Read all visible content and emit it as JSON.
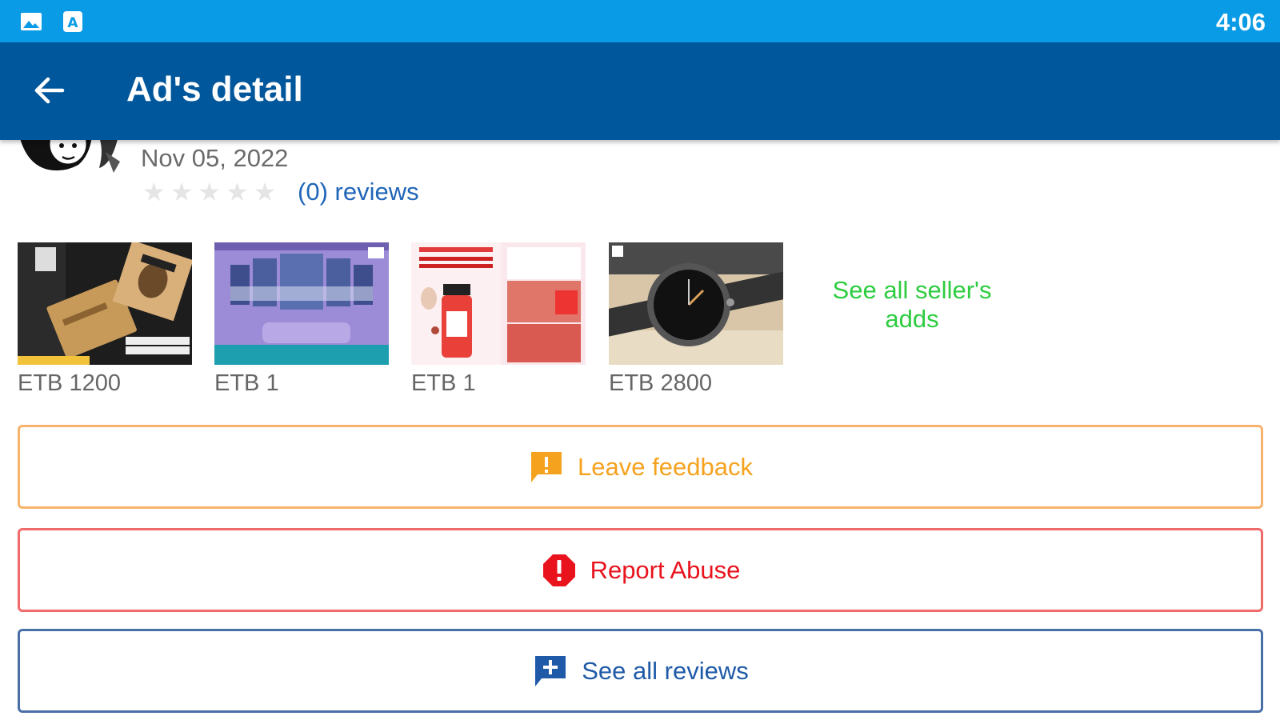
{
  "status_bar": {
    "time": "4:06",
    "icons": [
      "image-icon",
      "app-store-icon"
    ],
    "background": "#0a9be6"
  },
  "app_bar": {
    "title": "Ad's detail",
    "back_icon": "arrow-left-icon",
    "background": "#01579b"
  },
  "seller": {
    "date": "Nov 05, 2022",
    "rating": 0,
    "max_rating": 5,
    "reviews_label": "(0) reviews"
  },
  "seller_ads": [
    {
      "price": "ETB 1200",
      "image_desc": "wooden notebook"
    },
    {
      "price": "ETB 1",
      "image_desc": "wall art room"
    },
    {
      "price": "ETB 1",
      "image_desc": "skin serum"
    },
    {
      "price": "ETB 2800",
      "image_desc": "wrist watch"
    }
  ],
  "see_all_adds": "See all seller's adds",
  "buttons": {
    "feedback": {
      "label": "Leave feedback",
      "icon": "feedback-icon",
      "color": "#f5a21f"
    },
    "report": {
      "label": "Report Abuse",
      "icon": "alert-icon",
      "color": "#e8131d"
    },
    "reviews": {
      "label": "See all reviews",
      "icon": "add-comment-icon",
      "color": "#1f5aa8"
    }
  }
}
